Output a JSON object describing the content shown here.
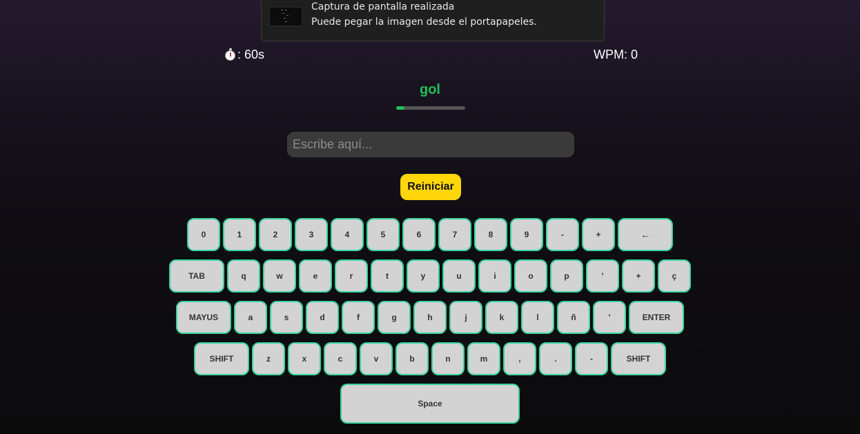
{
  "notification": {
    "title": "Captura de pantalla realizada",
    "body": "Puede pegar la imagen desde el portapapeles."
  },
  "stats": {
    "timer_icon": "stopwatch-icon",
    "timer_text": ": 60s",
    "wpm_text": "WPM: 0"
  },
  "current_word": "gol",
  "progress": {
    "fraction": 0.12,
    "color": "#1fc156"
  },
  "input": {
    "placeholder": "Escribe aquí...",
    "value": ""
  },
  "restart_label": "Reiniciar",
  "keyboard": {
    "rows": [
      [
        "0",
        "1",
        "2",
        "3",
        "4",
        "5",
        "6",
        "7",
        "8",
        "9",
        "-",
        "+",
        "←"
      ],
      [
        "TAB",
        "q",
        "w",
        "e",
        "r",
        "t",
        "y",
        "u",
        "i",
        "o",
        "p",
        "'",
        "+",
        "ç"
      ],
      [
        "MAYUS",
        "a",
        "s",
        "d",
        "f",
        "g",
        "h",
        "j",
        "k",
        "l",
        "ñ",
        "'",
        "ENTER"
      ],
      [
        "SHIFT",
        "z",
        "x",
        "c",
        "v",
        "b",
        "n",
        "m",
        ",",
        ".",
        "-",
        "SHIFT"
      ],
      [
        "Space"
      ]
    ]
  },
  "colors": {
    "accent_green": "#1fc156",
    "key_border": "#38d3a0",
    "key_bg": "#d3d3d3",
    "button_yellow": "#ffd60a"
  }
}
